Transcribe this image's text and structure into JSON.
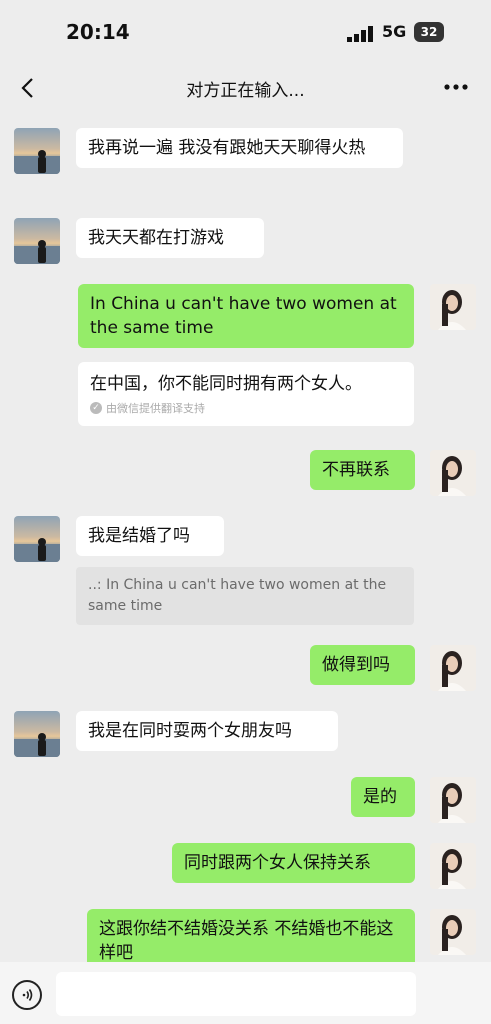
{
  "status": {
    "time": "20:14",
    "network": "5G",
    "battery": "32"
  },
  "nav": {
    "title": "对方正在输入..."
  },
  "messages": {
    "m1": "我再说一遍 我没有跟她天天聊得火热",
    "m2": "我天天都在打游戏",
    "m3": "In China u can't have two women at the same time",
    "m3_translation": "在中国，你不能同时拥有两个女人。",
    "m3_translation_source": "由微信提供翻译支持",
    "m4": "不再联系",
    "m5": "我是结婚了吗",
    "m5_quote": "..: In China u can't have two women at the same time",
    "m6": "做得到吗",
    "m7": "我是在同时耍两个女朋友吗",
    "m8": "是的",
    "m9": "同时跟两个女人保持关系",
    "m10": "这跟你结不结婚没关系 不结婚也不能这样吧"
  },
  "colors": {
    "green_bubble": "#95ec69",
    "background": "#ededed"
  }
}
